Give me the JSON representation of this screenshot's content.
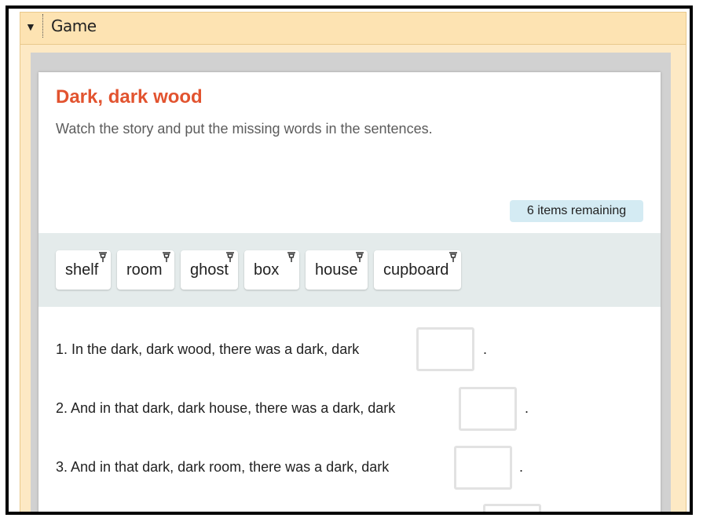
{
  "panel": {
    "toggle_icon": "triangle-down-icon",
    "title": "Game"
  },
  "activity": {
    "title": "Dark, dark wood",
    "instructions": "Watch the story and put the missing words in the sentences.",
    "remaining": "6 items remaining"
  },
  "word_bank": [
    "shelf",
    "room",
    "ghost",
    "box",
    "house",
    "cupboard"
  ],
  "sentences": [
    {
      "text": "1. In the dark, dark wood, there was a dark, dark",
      "end": "."
    },
    {
      "text": "2. And in that dark, dark house, there was a dark, dark",
      "end": "."
    },
    {
      "text": "3. And in that dark, dark room, there was a dark, dark",
      "end": "."
    }
  ],
  "colors": {
    "title": "#e2532f",
    "header_bg": "#fde3b2",
    "badge_bg": "#d4ebf3",
    "bank_bg": "#e4ebeb"
  }
}
